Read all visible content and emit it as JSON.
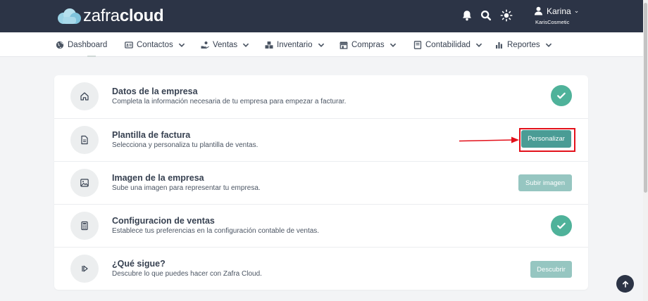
{
  "brand": {
    "logo_light": "zafra",
    "logo_bold": "cloud",
    "primary_color": "#2c3446",
    "accent": "#4fb29a"
  },
  "header": {
    "icons": [
      "bell-icon",
      "search-icon",
      "sun-icon"
    ],
    "user": {
      "name": "Karina",
      "company": "KarisCosmetic"
    }
  },
  "nav": {
    "items": [
      {
        "label": "Dashboard",
        "icon": "globe-icon",
        "dropdown": false
      },
      {
        "label": "Contactos",
        "icon": "id-card-icon",
        "dropdown": true
      },
      {
        "label": "Ventas",
        "icon": "hand-coin-icon",
        "dropdown": true
      },
      {
        "label": "Inventario",
        "icon": "boxes-icon",
        "dropdown": true
      },
      {
        "label": "Compras",
        "icon": "store-icon",
        "dropdown": true
      },
      {
        "label": "Contabilidad",
        "icon": "book-icon",
        "dropdown": true
      },
      {
        "label": "Reportes",
        "icon": "bar-chart-icon",
        "dropdown": true
      }
    ]
  },
  "steps": [
    {
      "title": "Datos de la empresa",
      "description": "Completa la información necesaria de tu empresa para empezar a facturar.",
      "icon": "home-icon",
      "status": "done"
    },
    {
      "title": "Plantilla de factura",
      "description": "Selecciona y personaliza tu plantilla de ventas.",
      "icon": "document-icon",
      "status": "action",
      "action_label": "Personalizar"
    },
    {
      "title": "Imagen de la empresa",
      "description": "Sube una imagen para representar tu empresa.",
      "icon": "image-icon",
      "status": "action",
      "action_label": "Subir imagen"
    },
    {
      "title": "Configuracion de ventas",
      "description": "Establece tus preferencias en la configuración contable de ventas.",
      "icon": "calculator-icon",
      "status": "done"
    },
    {
      "title": "¿Qué sigue?",
      "description": "Descubre lo que puedes hacer con Zafra Cloud.",
      "icon": "play-icon",
      "status": "action",
      "action_label": "Descubrir"
    }
  ]
}
